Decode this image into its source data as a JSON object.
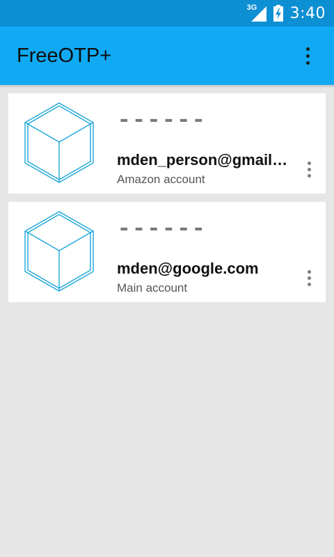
{
  "status_bar": {
    "network_type": "3G",
    "time": "3:40",
    "signal_icon": "cell-signal-icon",
    "battery_icon": "battery-charging-icon"
  },
  "app_bar": {
    "title": "FreeOTP+",
    "menu_icon": "more-vert-icon",
    "background_color": "#10aaf4"
  },
  "tokens": [
    {
      "code": "------",
      "label": "mden_person@gmail.com",
      "issuer": "Amazon account",
      "image_icon": "cube-icon"
    },
    {
      "code": "------",
      "label": "mden@google.com",
      "issuer": "Main account",
      "image_icon": "cube-icon"
    }
  ],
  "colors": {
    "status_bar": "#0d8fd3",
    "accent": "#10aaf4",
    "cube_stroke": "#1aa6d8",
    "background": "#e6e6e6"
  }
}
